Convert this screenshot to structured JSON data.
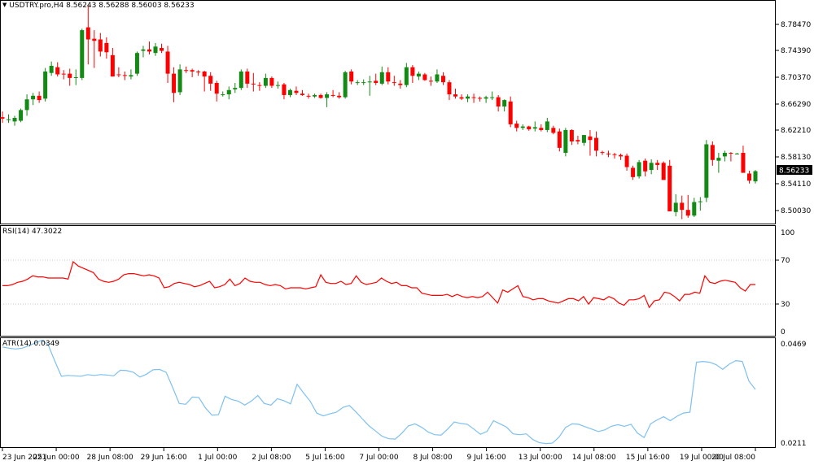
{
  "window": {
    "symbol_timeframe": "USDTRY.pro,H4",
    "ohlc": "8.56243 8.56288 8.56003 8.56233",
    "dropdown_icon": "triangle-down-icon"
  },
  "colors": {
    "bull": "#138a13",
    "bear": "#ff0000",
    "rsi": "#ff0000",
    "atr": "#7ec0f0",
    "grid": "#c8c8c8",
    "frame": "#000000",
    "price_tag_bg": "#000000",
    "price_tag_fg": "#ffffff"
  },
  "price_panel": {
    "axis_labels": [
      "8.78470",
      "8.74390",
      "8.70370",
      "8.66290",
      "8.62210",
      "8.58130",
      "8.54110",
      "8.50030"
    ],
    "current_price": "8.56233"
  },
  "rsi_panel": {
    "label": "RSI(14) 47.3022",
    "axis_labels": [
      "100",
      "70",
      "30",
      "0"
    ]
  },
  "atr_panel": {
    "label": "ATR(14) 0.0349",
    "axis_labels": [
      "0.0469",
      "0.0211"
    ]
  },
  "time_axis": {
    "labels": [
      "23 Jun 2021",
      "25 Jun 00:00",
      "28 Jun 08:00",
      "29 Jun 16:00",
      "1 Jul 00:00",
      "2 Jul 08:00",
      "5 Jul 16:00",
      "7 Jul 00:00",
      "8 Jul 08:00",
      "9 Jul 16:00",
      "13 Jul 00:00",
      "14 Jul 08:00",
      "15 Jul 16:00",
      "19 Jul 00:00",
      "20 Jul 08:00"
    ]
  },
  "chart_data": [
    {
      "type": "candlestick",
      "title": "USDTRY.pro,H4",
      "ylim": [
        8.49,
        8.8
      ],
      "candles": [
        {
          "o": 8.638,
          "h": 8.646,
          "l": 8.63,
          "c": 8.636
        },
        {
          "o": 8.634,
          "h": 8.642,
          "l": 8.63,
          "c": 8.635
        },
        {
          "o": 8.632,
          "h": 8.64,
          "l": 8.626,
          "c": 8.637
        },
        {
          "o": 8.633,
          "h": 8.65,
          "l": 8.631,
          "c": 8.648
        },
        {
          "o": 8.648,
          "h": 8.67,
          "l": 8.64,
          "c": 8.663
        },
        {
          "o": 8.663,
          "h": 8.672,
          "l": 8.655,
          "c": 8.668
        },
        {
          "o": 8.668,
          "h": 8.674,
          "l": 8.658,
          "c": 8.662
        },
        {
          "o": 8.664,
          "h": 8.707,
          "l": 8.66,
          "c": 8.702
        },
        {
          "o": 8.7,
          "h": 8.716,
          "l": 8.696,
          "c": 8.71
        },
        {
          "o": 8.708,
          "h": 8.715,
          "l": 8.695,
          "c": 8.698
        },
        {
          "o": 8.699,
          "h": 8.704,
          "l": 8.691,
          "c": 8.698
        },
        {
          "o": 8.699,
          "h": 8.706,
          "l": 8.682,
          "c": 8.693
        },
        {
          "o": 8.694,
          "h": 8.705,
          "l": 8.683,
          "c": 8.694
        },
        {
          "o": 8.693,
          "h": 8.762,
          "l": 8.69,
          "c": 8.76
        },
        {
          "o": 8.764,
          "h": 8.795,
          "l": 8.712,
          "c": 8.747
        },
        {
          "o": 8.748,
          "h": 8.76,
          "l": 8.707,
          "c": 8.745
        },
        {
          "o": 8.747,
          "h": 8.756,
          "l": 8.723,
          "c": 8.73
        },
        {
          "o": 8.742,
          "h": 8.75,
          "l": 8.72,
          "c": 8.729
        },
        {
          "o": 8.725,
          "h": 8.735,
          "l": 8.695,
          "c": 8.695
        },
        {
          "o": 8.698,
          "h": 8.708,
          "l": 8.694,
          "c": 8.697
        },
        {
          "o": 8.697,
          "h": 8.702,
          "l": 8.69,
          "c": 8.696
        },
        {
          "o": 8.695,
          "h": 8.705,
          "l": 8.691,
          "c": 8.697
        },
        {
          "o": 8.699,
          "h": 8.73,
          "l": 8.696,
          "c": 8.728
        },
        {
          "o": 8.731,
          "h": 8.738,
          "l": 8.722,
          "c": 8.733
        },
        {
          "o": 8.733,
          "h": 8.744,
          "l": 8.726,
          "c": 8.73
        },
        {
          "o": 8.728,
          "h": 8.742,
          "l": 8.724,
          "c": 8.737
        },
        {
          "o": 8.735,
          "h": 8.741,
          "l": 8.728,
          "c": 8.731
        },
        {
          "o": 8.73,
          "h": 8.738,
          "l": 8.686,
          "c": 8.699
        },
        {
          "o": 8.699,
          "h": 8.708,
          "l": 8.659,
          "c": 8.672
        },
        {
          "o": 8.673,
          "h": 8.712,
          "l": 8.669,
          "c": 8.705
        },
        {
          "o": 8.704,
          "h": 8.709,
          "l": 8.7,
          "c": 8.703
        },
        {
          "o": 8.704,
          "h": 8.706,
          "l": 8.694,
          "c": 8.702
        },
        {
          "o": 8.702,
          "h": 8.704,
          "l": 8.696,
          "c": 8.701
        },
        {
          "o": 8.702,
          "h": 8.703,
          "l": 8.674,
          "c": 8.695
        },
        {
          "o": 8.696,
          "h": 8.701,
          "l": 8.675,
          "c": 8.685
        },
        {
          "o": 8.686,
          "h": 8.689,
          "l": 8.66,
          "c": 8.671
        },
        {
          "o": 8.67,
          "h": 8.674,
          "l": 8.667,
          "c": 8.67
        },
        {
          "o": 8.67,
          "h": 8.681,
          "l": 8.663,
          "c": 8.676
        },
        {
          "o": 8.677,
          "h": 8.686,
          "l": 8.672,
          "c": 8.679
        },
        {
          "o": 8.679,
          "h": 8.705,
          "l": 8.676,
          "c": 8.702
        },
        {
          "o": 8.702,
          "h": 8.706,
          "l": 8.679,
          "c": 8.685
        },
        {
          "o": 8.685,
          "h": 8.7,
          "l": 8.674,
          "c": 8.684
        },
        {
          "o": 8.683,
          "h": 8.687,
          "l": 8.675,
          "c": 8.682
        },
        {
          "o": 8.682,
          "h": 8.699,
          "l": 8.679,
          "c": 8.693
        },
        {
          "o": 8.693,
          "h": 8.695,
          "l": 8.679,
          "c": 8.682
        },
        {
          "o": 8.682,
          "h": 8.688,
          "l": 8.678,
          "c": 8.683
        },
        {
          "o": 8.684,
          "h": 8.686,
          "l": 8.663,
          "c": 8.669
        },
        {
          "o": 8.669,
          "h": 8.678,
          "l": 8.666,
          "c": 8.676
        },
        {
          "o": 8.675,
          "h": 8.681,
          "l": 8.669,
          "c": 8.672
        },
        {
          "o": 8.671,
          "h": 8.676,
          "l": 8.668,
          "c": 8.669
        },
        {
          "o": 8.668,
          "h": 8.671,
          "l": 8.664,
          "c": 8.667
        },
        {
          "o": 8.667,
          "h": 8.671,
          "l": 8.665,
          "c": 8.669
        },
        {
          "o": 8.669,
          "h": 8.671,
          "l": 8.664,
          "c": 8.665
        },
        {
          "o": 8.665,
          "h": 8.673,
          "l": 8.652,
          "c": 8.67
        },
        {
          "o": 8.669,
          "h": 8.676,
          "l": 8.666,
          "c": 8.668
        },
        {
          "o": 8.668,
          "h": 8.673,
          "l": 8.664,
          "c": 8.666
        },
        {
          "o": 8.666,
          "h": 8.703,
          "l": 8.664,
          "c": 8.701
        },
        {
          "o": 8.702,
          "h": 8.705,
          "l": 8.684,
          "c": 8.688
        },
        {
          "o": 8.686,
          "h": 8.69,
          "l": 8.683,
          "c": 8.687
        },
        {
          "o": 8.686,
          "h": 8.691,
          "l": 8.683,
          "c": 8.687
        },
        {
          "o": 8.687,
          "h": 8.696,
          "l": 8.668,
          "c": 8.688
        },
        {
          "o": 8.689,
          "h": 8.699,
          "l": 8.683,
          "c": 8.686
        },
        {
          "o": 8.685,
          "h": 8.709,
          "l": 8.683,
          "c": 8.701
        },
        {
          "o": 8.701,
          "h": 8.708,
          "l": 8.684,
          "c": 8.688
        },
        {
          "o": 8.687,
          "h": 8.696,
          "l": 8.682,
          "c": 8.686
        },
        {
          "o": 8.685,
          "h": 8.69,
          "l": 8.678,
          "c": 8.683
        },
        {
          "o": 8.683,
          "h": 8.714,
          "l": 8.68,
          "c": 8.708
        },
        {
          "o": 8.708,
          "h": 8.711,
          "l": 8.686,
          "c": 8.696
        },
        {
          "o": 8.695,
          "h": 8.702,
          "l": 8.69,
          "c": 8.699
        },
        {
          "o": 8.698,
          "h": 8.7,
          "l": 8.689,
          "c": 8.69
        },
        {
          "o": 8.689,
          "h": 8.695,
          "l": 8.682,
          "c": 8.688
        },
        {
          "o": 8.688,
          "h": 8.705,
          "l": 8.686,
          "c": 8.698
        },
        {
          "o": 8.696,
          "h": 8.701,
          "l": 8.683,
          "c": 8.687
        },
        {
          "o": 8.687,
          "h": 8.69,
          "l": 8.662,
          "c": 8.67
        },
        {
          "o": 8.67,
          "h": 8.678,
          "l": 8.664,
          "c": 8.667
        },
        {
          "o": 8.666,
          "h": 8.67,
          "l": 8.662,
          "c": 8.664
        },
        {
          "o": 8.664,
          "h": 8.67,
          "l": 8.659,
          "c": 8.667
        },
        {
          "o": 8.666,
          "h": 8.671,
          "l": 8.658,
          "c": 8.665
        },
        {
          "o": 8.665,
          "h": 8.667,
          "l": 8.66,
          "c": 8.664
        },
        {
          "o": 8.664,
          "h": 8.668,
          "l": 8.658,
          "c": 8.666
        },
        {
          "o": 8.666,
          "h": 8.674,
          "l": 8.662,
          "c": 8.666
        },
        {
          "o": 8.666,
          "h": 8.669,
          "l": 8.646,
          "c": 8.653
        },
        {
          "o": 8.653,
          "h": 8.663,
          "l": 8.646,
          "c": 8.662
        },
        {
          "o": 8.66,
          "h": 8.667,
          "l": 8.624,
          "c": 8.628
        },
        {
          "o": 8.629,
          "h": 8.633,
          "l": 8.618,
          "c": 8.623
        },
        {
          "o": 8.623,
          "h": 8.628,
          "l": 8.62,
          "c": 8.625
        },
        {
          "o": 8.625,
          "h": 8.626,
          "l": 8.619,
          "c": 8.621
        },
        {
          "o": 8.622,
          "h": 8.632,
          "l": 8.618,
          "c": 8.624
        },
        {
          "o": 8.623,
          "h": 8.628,
          "l": 8.618,
          "c": 8.62
        },
        {
          "o": 8.62,
          "h": 8.637,
          "l": 8.617,
          "c": 8.632
        },
        {
          "o": 8.623,
          "h": 8.626,
          "l": 8.614,
          "c": 8.616
        },
        {
          "o": 8.618,
          "h": 8.622,
          "l": 8.59,
          "c": 8.595
        },
        {
          "o": 8.588,
          "h": 8.623,
          "l": 8.583,
          "c": 8.62
        },
        {
          "o": 8.62,
          "h": 8.621,
          "l": 8.599,
          "c": 8.604
        },
        {
          "o": 8.606,
          "h": 8.612,
          "l": 8.6,
          "c": 8.604
        },
        {
          "o": 8.602,
          "h": 8.613,
          "l": 8.598,
          "c": 8.613
        },
        {
          "o": 8.611,
          "h": 8.62,
          "l": 8.584,
          "c": 8.606
        },
        {
          "o": 8.609,
          "h": 8.618,
          "l": 8.583,
          "c": 8.591
        },
        {
          "o": 8.589,
          "h": 8.591,
          "l": 8.585,
          "c": 8.588
        },
        {
          "o": 8.587,
          "h": 8.591,
          "l": 8.582,
          "c": 8.586
        },
        {
          "o": 8.586,
          "h": 8.588,
          "l": 8.58,
          "c": 8.585
        },
        {
          "o": 8.585,
          "h": 8.587,
          "l": 8.578,
          "c": 8.583
        },
        {
          "o": 8.584,
          "h": 8.587,
          "l": 8.563,
          "c": 8.568
        },
        {
          "o": 8.567,
          "h": 8.57,
          "l": 8.55,
          "c": 8.554
        },
        {
          "o": 8.555,
          "h": 8.578,
          "l": 8.552,
          "c": 8.575
        },
        {
          "o": 8.577,
          "h": 8.58,
          "l": 8.555,
          "c": 8.562
        },
        {
          "o": 8.564,
          "h": 8.579,
          "l": 8.558,
          "c": 8.574
        },
        {
          "o": 8.574,
          "h": 8.578,
          "l": 8.564,
          "c": 8.571
        },
        {
          "o": 8.574,
          "h": 8.576,
          "l": 8.56,
          "c": 8.55
        },
        {
          "o": 8.57,
          "h": 8.578,
          "l": 8.506,
          "c": 8.506
        },
        {
          "o": 8.505,
          "h": 8.53,
          "l": 8.499,
          "c": 8.518
        },
        {
          "o": 8.518,
          "h": 8.528,
          "l": 8.495,
          "c": 8.508
        },
        {
          "o": 8.508,
          "h": 8.529,
          "l": 8.497,
          "c": 8.5
        },
        {
          "o": 8.5,
          "h": 8.525,
          "l": 8.498,
          "c": 8.519
        },
        {
          "o": 8.519,
          "h": 8.526,
          "l": 8.507,
          "c": 8.52
        },
        {
          "o": 8.525,
          "h": 8.606,
          "l": 8.519,
          "c": 8.6
        },
        {
          "o": 8.599,
          "h": 8.604,
          "l": 8.57,
          "c": 8.578
        },
        {
          "o": 8.577,
          "h": 8.588,
          "l": 8.56,
          "c": 8.581
        },
        {
          "o": 8.583,
          "h": 8.591,
          "l": 8.576,
          "c": 8.588
        },
        {
          "o": 8.588,
          "h": 8.589,
          "l": 8.576,
          "c": 8.587
        },
        {
          "o": 8.587,
          "h": 8.588,
          "l": 8.586,
          "c": 8.587
        },
        {
          "o": 8.588,
          "h": 8.598,
          "l": 8.56,
          "c": 8.56
        },
        {
          "o": 8.559,
          "h": 8.563,
          "l": 8.545,
          "c": 8.549
        },
        {
          "o": 8.548,
          "h": 8.564,
          "l": 8.545,
          "c": 8.5623
        }
      ]
    },
    {
      "type": "line",
      "title": "RSI(14) 47.3022",
      "ylim": [
        0,
        100
      ],
      "series": [
        {
          "values": [
            46,
            46,
            47,
            49,
            50,
            52,
            55,
            54,
            54,
            53,
            53,
            53,
            53,
            52,
            68,
            64,
            62,
            60,
            58,
            52,
            50,
            49,
            50,
            52,
            56,
            57,
            57,
            56,
            55,
            56,
            55,
            53,
            44,
            45,
            48,
            49,
            48,
            47,
            45,
            46,
            48,
            50,
            44,
            45,
            47,
            52,
            46,
            48,
            53,
            50,
            49,
            49,
            47,
            46,
            47,
            46,
            43,
            44,
            44,
            44,
            43,
            44,
            45,
            56,
            49,
            48,
            48,
            50,
            47,
            48,
            55,
            49,
            47,
            48,
            49,
            53,
            50,
            48,
            49,
            46,
            46,
            44,
            44,
            39,
            38,
            37,
            37,
            37,
            38,
            36,
            38,
            36,
            35,
            36,
            35,
            36,
            40,
            35,
            30,
            42,
            40,
            43,
            46,
            36,
            35,
            33,
            34,
            34,
            32,
            31,
            30,
            32,
            34,
            34,
            32,
            36,
            29,
            35,
            34,
            33,
            36,
            34,
            30,
            28,
            33,
            33,
            34,
            37,
            26,
            32,
            33,
            40,
            39,
            36,
            32,
            38,
            38,
            40,
            39,
            55,
            49,
            48,
            50,
            51,
            50,
            49,
            44,
            41,
            47,
            47
          ]
        }
      ]
    },
    {
      "type": "line",
      "title": "ATR(14) 0.0349",
      "ylim": [
        0.0205,
        0.0475
      ],
      "series": [
        {
          "values": [
            0.0455,
            0.0452,
            0.045,
            0.0452,
            0.0458,
            0.0465,
            0.0472,
            0.046,
            0.042,
            0.0382,
            0.0384,
            0.0383,
            0.0382,
            0.0386,
            0.0384,
            0.0386,
            0.0385,
            0.0383,
            0.0397,
            0.0396,
            0.0392,
            0.038,
            0.0387,
            0.0398,
            0.0399,
            0.0392,
            0.0354,
            0.0314,
            0.0312,
            0.033,
            0.0329,
            0.0303,
            0.0285,
            0.0286,
            0.0332,
            0.0324,
            0.032,
            0.031,
            0.032,
            0.0334,
            0.0314,
            0.031,
            0.0326,
            0.0321,
            0.0313,
            0.0362,
            0.034,
            0.032,
            0.029,
            0.0283,
            0.0288,
            0.0292,
            0.0304,
            0.0309,
            0.0293,
            0.0275,
            0.0258,
            0.0245,
            0.0232,
            0.0226,
            0.0225,
            0.024,
            0.0258,
            0.0263,
            0.0255,
            0.0243,
            0.0236,
            0.0235,
            0.025,
            0.0268,
            0.0264,
            0.0262,
            0.025,
            0.0237,
            0.0244,
            0.0271,
            0.0263,
            0.0255,
            0.0238,
            0.0236,
            0.0238,
            0.0224,
            0.0216,
            0.0214,
            0.0215,
            0.023,
            0.0254,
            0.0263,
            0.0262,
            0.0256,
            0.025,
            0.0244,
            0.0248,
            0.0257,
            0.0261,
            0.0257,
            0.0262,
            0.024,
            0.0229,
            0.0263,
            0.0273,
            0.0281,
            0.0271,
            0.0282,
            0.029,
            0.0292,
            0.0417,
            0.0419,
            0.0417,
            0.0411,
            0.0399,
            0.0412,
            0.0421,
            0.0419,
            0.037,
            0.0349
          ]
        }
      ]
    }
  ]
}
